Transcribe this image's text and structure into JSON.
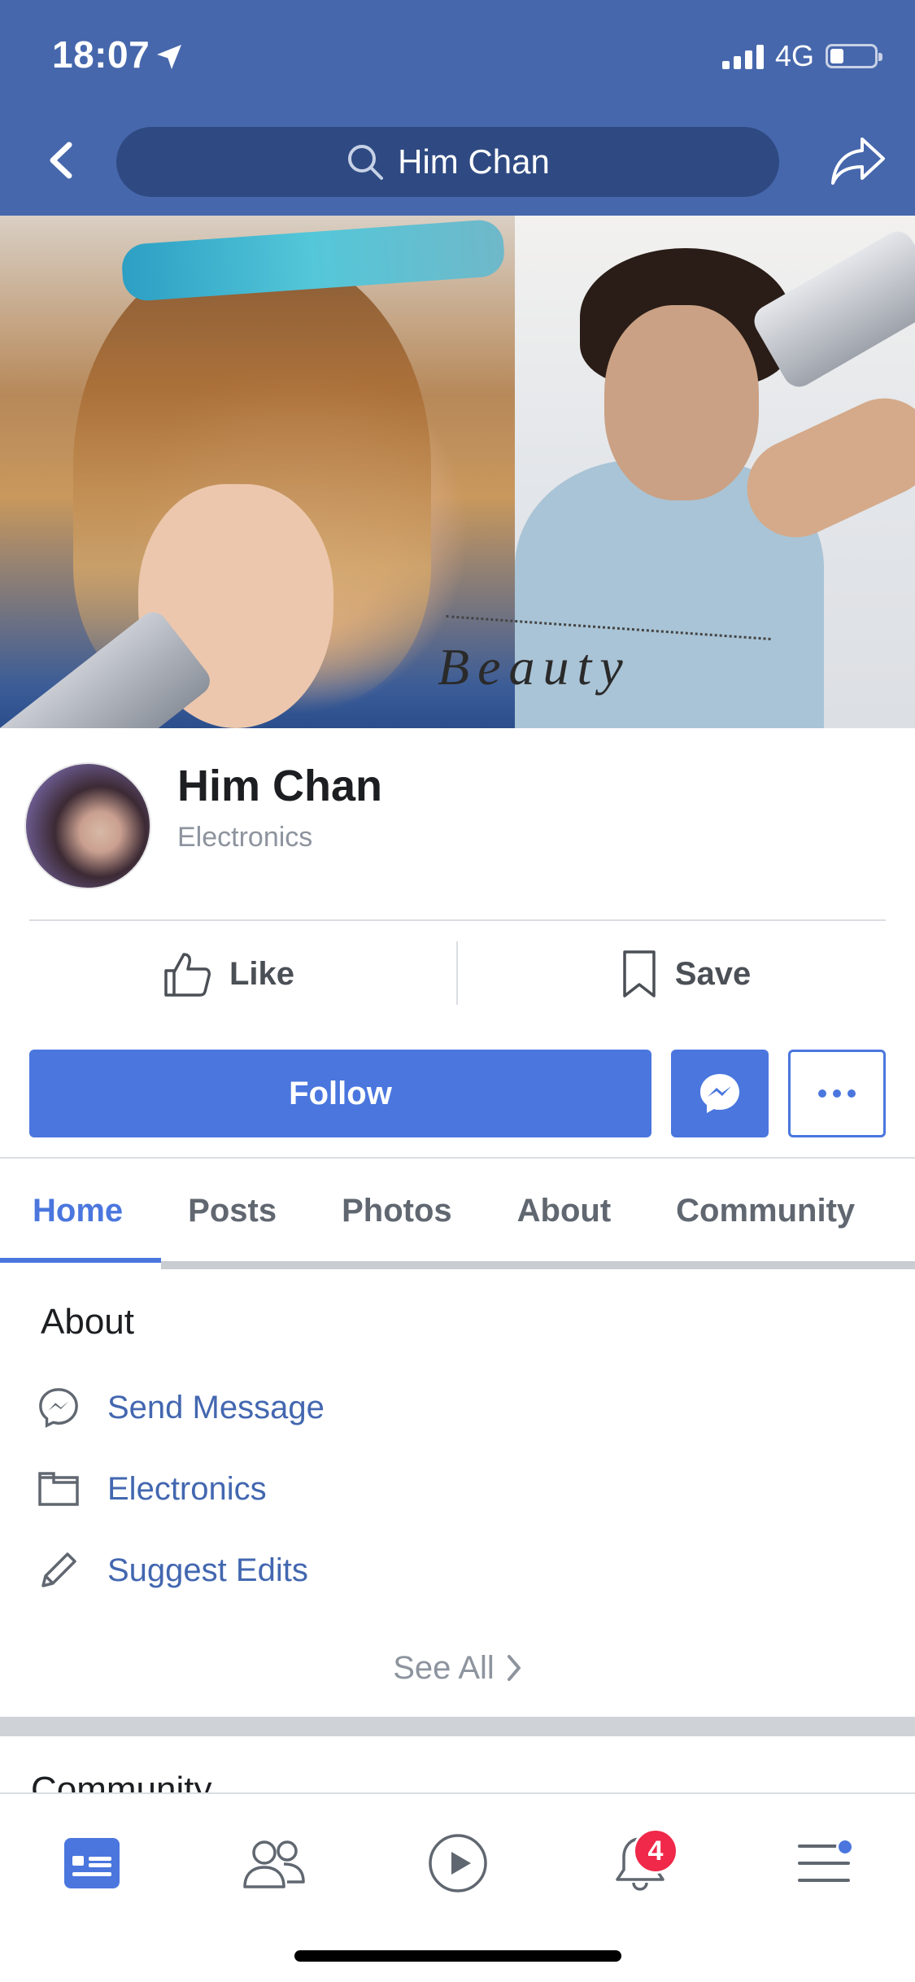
{
  "status_bar": {
    "time": "18:07",
    "network": "4G",
    "battery_percent": 25,
    "signal_bars": 4
  },
  "nav": {
    "search_text": "Him Chan"
  },
  "cover": {
    "caption": "Beauty"
  },
  "profile": {
    "name": "Him Chan",
    "category": "Electronics"
  },
  "actions": {
    "like_label": "Like",
    "save_label": "Save"
  },
  "follow": {
    "label": "Follow"
  },
  "tabs": [
    {
      "label": "Home",
      "active": true
    },
    {
      "label": "Posts",
      "active": false
    },
    {
      "label": "Photos",
      "active": false
    },
    {
      "label": "About",
      "active": false
    },
    {
      "label": "Community",
      "active": false
    }
  ],
  "about": {
    "title": "About",
    "items": [
      {
        "label": "Send Message",
        "icon": "messenger-outline-icon"
      },
      {
        "label": "Electronics",
        "icon": "folder-icon"
      },
      {
        "label": "Suggest Edits",
        "icon": "pencil-icon"
      }
    ],
    "see_all": "See All"
  },
  "next_section": {
    "title": "Community"
  },
  "tab_bar": {
    "items": [
      "news-feed-icon",
      "friends-icon",
      "watch-icon",
      "notifications-icon",
      "menu-icon"
    ],
    "notification_count": "4"
  },
  "colors": {
    "brand": "#4667ac",
    "accent": "#4a76de",
    "link": "#4367b0",
    "badge": "#f02849"
  }
}
